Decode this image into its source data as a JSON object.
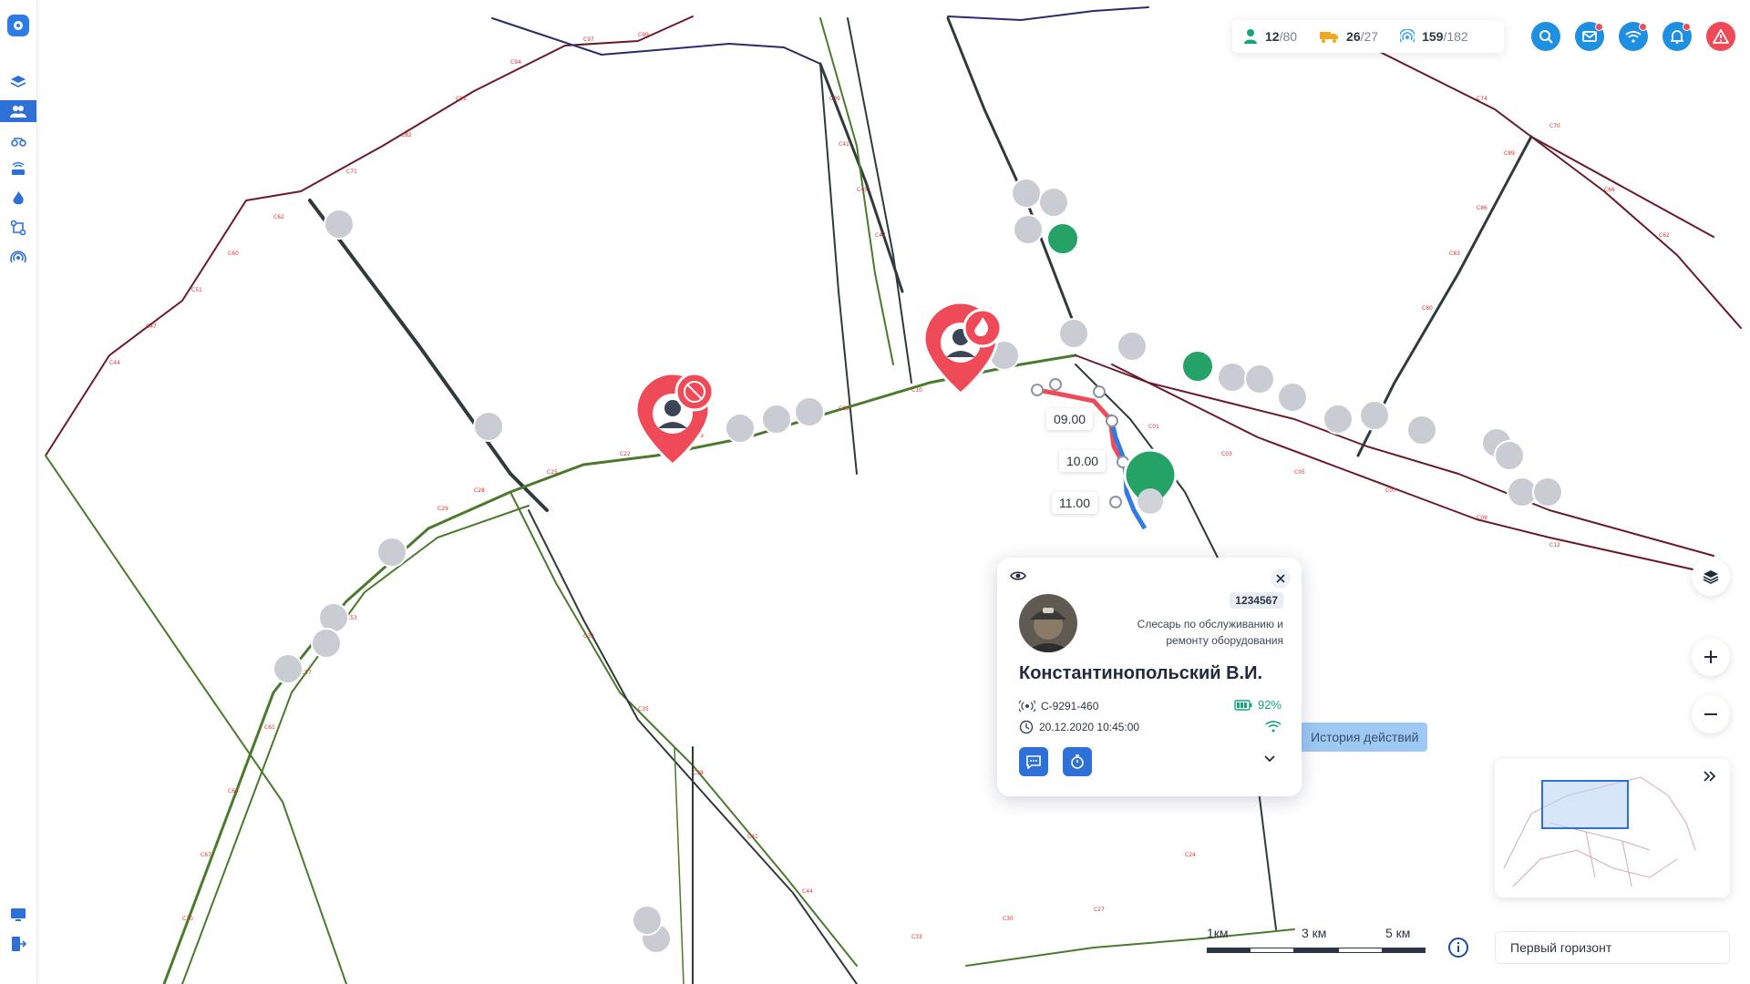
{
  "stats": {
    "people": {
      "current": "12",
      "total": "80",
      "icon": "person-icon",
      "color": "#14a37f"
    },
    "vehicles": {
      "current": "26",
      "total": "27",
      "icon": "truck-icon",
      "color": "#f0a821"
    },
    "tags": {
      "current": "159",
      "total": "182",
      "icon": "beacon-icon",
      "color": "#3aa8e8"
    }
  },
  "top_buttons": [
    {
      "name": "search-button",
      "icon": "search-icon",
      "color": "#1e8fe1",
      "badge": false
    },
    {
      "name": "mail-button",
      "icon": "mail-icon",
      "color": "#1e8fe1",
      "badge": true
    },
    {
      "name": "wifi-button",
      "icon": "wifi-icon",
      "color": "#1e8fe1",
      "badge": true
    },
    {
      "name": "notifications-button",
      "icon": "bell-icon",
      "color": "#1e8fe1",
      "badge": true
    },
    {
      "name": "alarm-button",
      "icon": "warning-icon",
      "color": "#ef4a57",
      "badge": false
    }
  ],
  "sidebar": {
    "items": [
      {
        "name": "sidebar-item-layers",
        "icon": "layers-icon",
        "active": false
      },
      {
        "name": "sidebar-item-people",
        "icon": "people-icon",
        "active": true
      },
      {
        "name": "sidebar-item-vehicles",
        "icon": "vehicle-icon",
        "active": false
      },
      {
        "name": "sidebar-item-network",
        "icon": "router-icon",
        "active": false
      },
      {
        "name": "sidebar-item-fire",
        "icon": "fire-icon",
        "active": false
      },
      {
        "name": "sidebar-item-routes",
        "icon": "route-icon",
        "active": false
      },
      {
        "name": "sidebar-item-beacons",
        "icon": "beacon-icon",
        "active": false
      }
    ],
    "bottom": [
      {
        "name": "sidebar-item-monitor",
        "icon": "monitor-icon"
      },
      {
        "name": "sidebar-item-logout",
        "icon": "logout-icon"
      }
    ]
  },
  "route_times": [
    "09.00",
    "10.00",
    "11.00"
  ],
  "card": {
    "tab_number": "1234567",
    "role": "Слесарь по обслуживанию и ремонту оборудования",
    "name": "Константинопольский В.И.",
    "device": "С-9291-460",
    "timestamp": "20.12.2020 10:45:00",
    "battery": "92%"
  },
  "history_label": "История действий",
  "scale": {
    "labels": [
      "1км",
      "3 км",
      "5 км"
    ]
  },
  "horizon": {
    "value": "Первый горизонт"
  },
  "colors": {
    "accent": "#2e6fd8",
    "alarm": "#ef4a57",
    "ok": "#25a266",
    "tunnel": "#4a7a2c",
    "tunnel_dark": "#6b1a2a"
  }
}
